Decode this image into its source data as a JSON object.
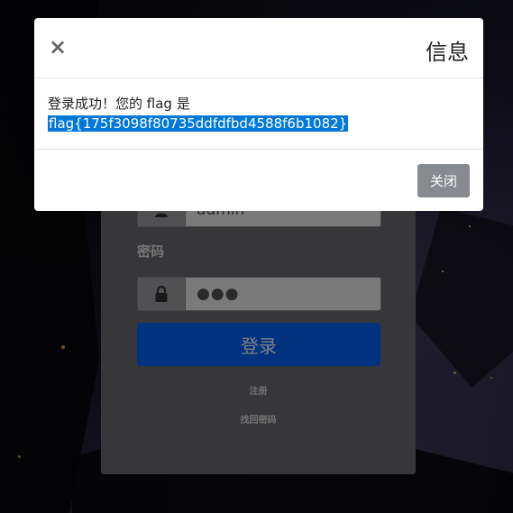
{
  "login_form": {
    "username_value": "admin",
    "password_label": "密码",
    "password_value": "●●●",
    "login_label": "登录",
    "register_link": "注册",
    "recover_link": "找回密码"
  },
  "modal": {
    "close_symbol": "×",
    "title": "信息",
    "message_prefix": "登录成功！您的 flag 是",
    "flag_text": "flag{175f3098f80735ddfdfbd4588f6b1082}",
    "close_button_label": "关闭"
  },
  "colors": {
    "primary_button": "#0066ff",
    "selection_highlight": "#0078d7",
    "secondary_button": "#878a8e"
  },
  "icons": {
    "username": "user-icon",
    "password": "lock-icon"
  }
}
